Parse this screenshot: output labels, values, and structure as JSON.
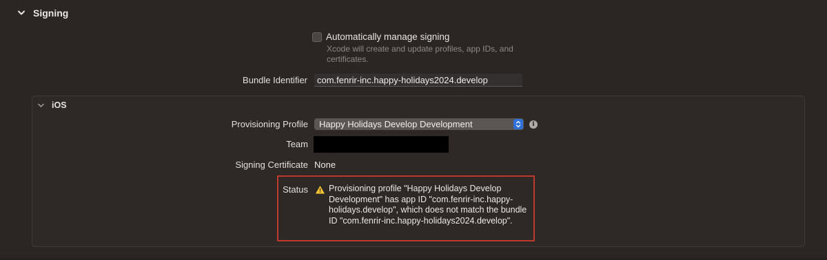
{
  "signing": {
    "section_title": "Signing",
    "auto_manage": {
      "label": "Automatically manage signing",
      "checked": false,
      "description": "Xcode will create and update profiles, app IDs, and certificates."
    },
    "bundle_identifier": {
      "label": "Bundle Identifier",
      "value": "com.fenrir-inc.happy-holidays2024.develop"
    }
  },
  "ios": {
    "section_title": "iOS",
    "provisioning_profile": {
      "label": "Provisioning Profile",
      "value": "Happy Holidays Develop Development"
    },
    "team": {
      "label": "Team",
      "value": ""
    },
    "signing_certificate": {
      "label": "Signing Certificate",
      "value": "None"
    },
    "status": {
      "label": "Status",
      "message": "Provisioning profile \"Happy Holidays Develop Development\" has app ID \"com.fenrir-inc.happy-holidays.develop\", which does not match the bundle ID \"com.fenrir-inc.happy-holidays2024.develop\"."
    }
  },
  "colors": {
    "background": "#2b2624",
    "popup_accent": "#2f6fd9",
    "highlight_border": "#c0392b",
    "warning": "#f1c232"
  },
  "icons": {
    "section_chevron": "chevron-down-icon",
    "ios_chevron": "chevron-down-icon",
    "info": "info-icon",
    "warning": "warning-icon",
    "popup": "up-down-arrows-icon"
  }
}
